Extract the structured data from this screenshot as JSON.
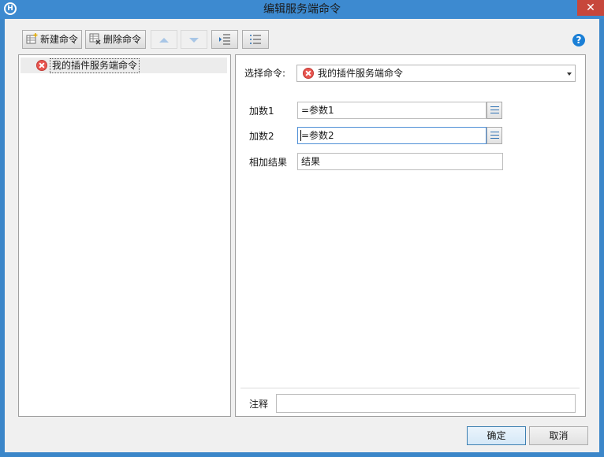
{
  "window": {
    "title": "编辑服务端命令",
    "close_glyph": "✕",
    "app_icon_glyph": "H"
  },
  "toolbar": {
    "new_label": "新建命令",
    "delete_label": "删除命令",
    "help_glyph": "?"
  },
  "tree": {
    "items": [
      {
        "label": "我的插件服务端命令",
        "icon": "error-circle-icon"
      }
    ]
  },
  "form": {
    "select_label": "选择命令:",
    "select_value": "我的插件服务端命令",
    "params": [
      {
        "label": "加数1",
        "value": "=参数1"
      },
      {
        "label": "加数2",
        "value": "=参数2"
      }
    ],
    "result_label": "相加结果",
    "result_value": "结果",
    "note_label": "注释",
    "note_value": ""
  },
  "buttons": {
    "ok": "确定",
    "cancel": "取消"
  },
  "colors": {
    "titlebar": "#3d8ad0",
    "close": "#c7473c",
    "error": "#e8554f",
    "help": "#1a7fd6"
  }
}
